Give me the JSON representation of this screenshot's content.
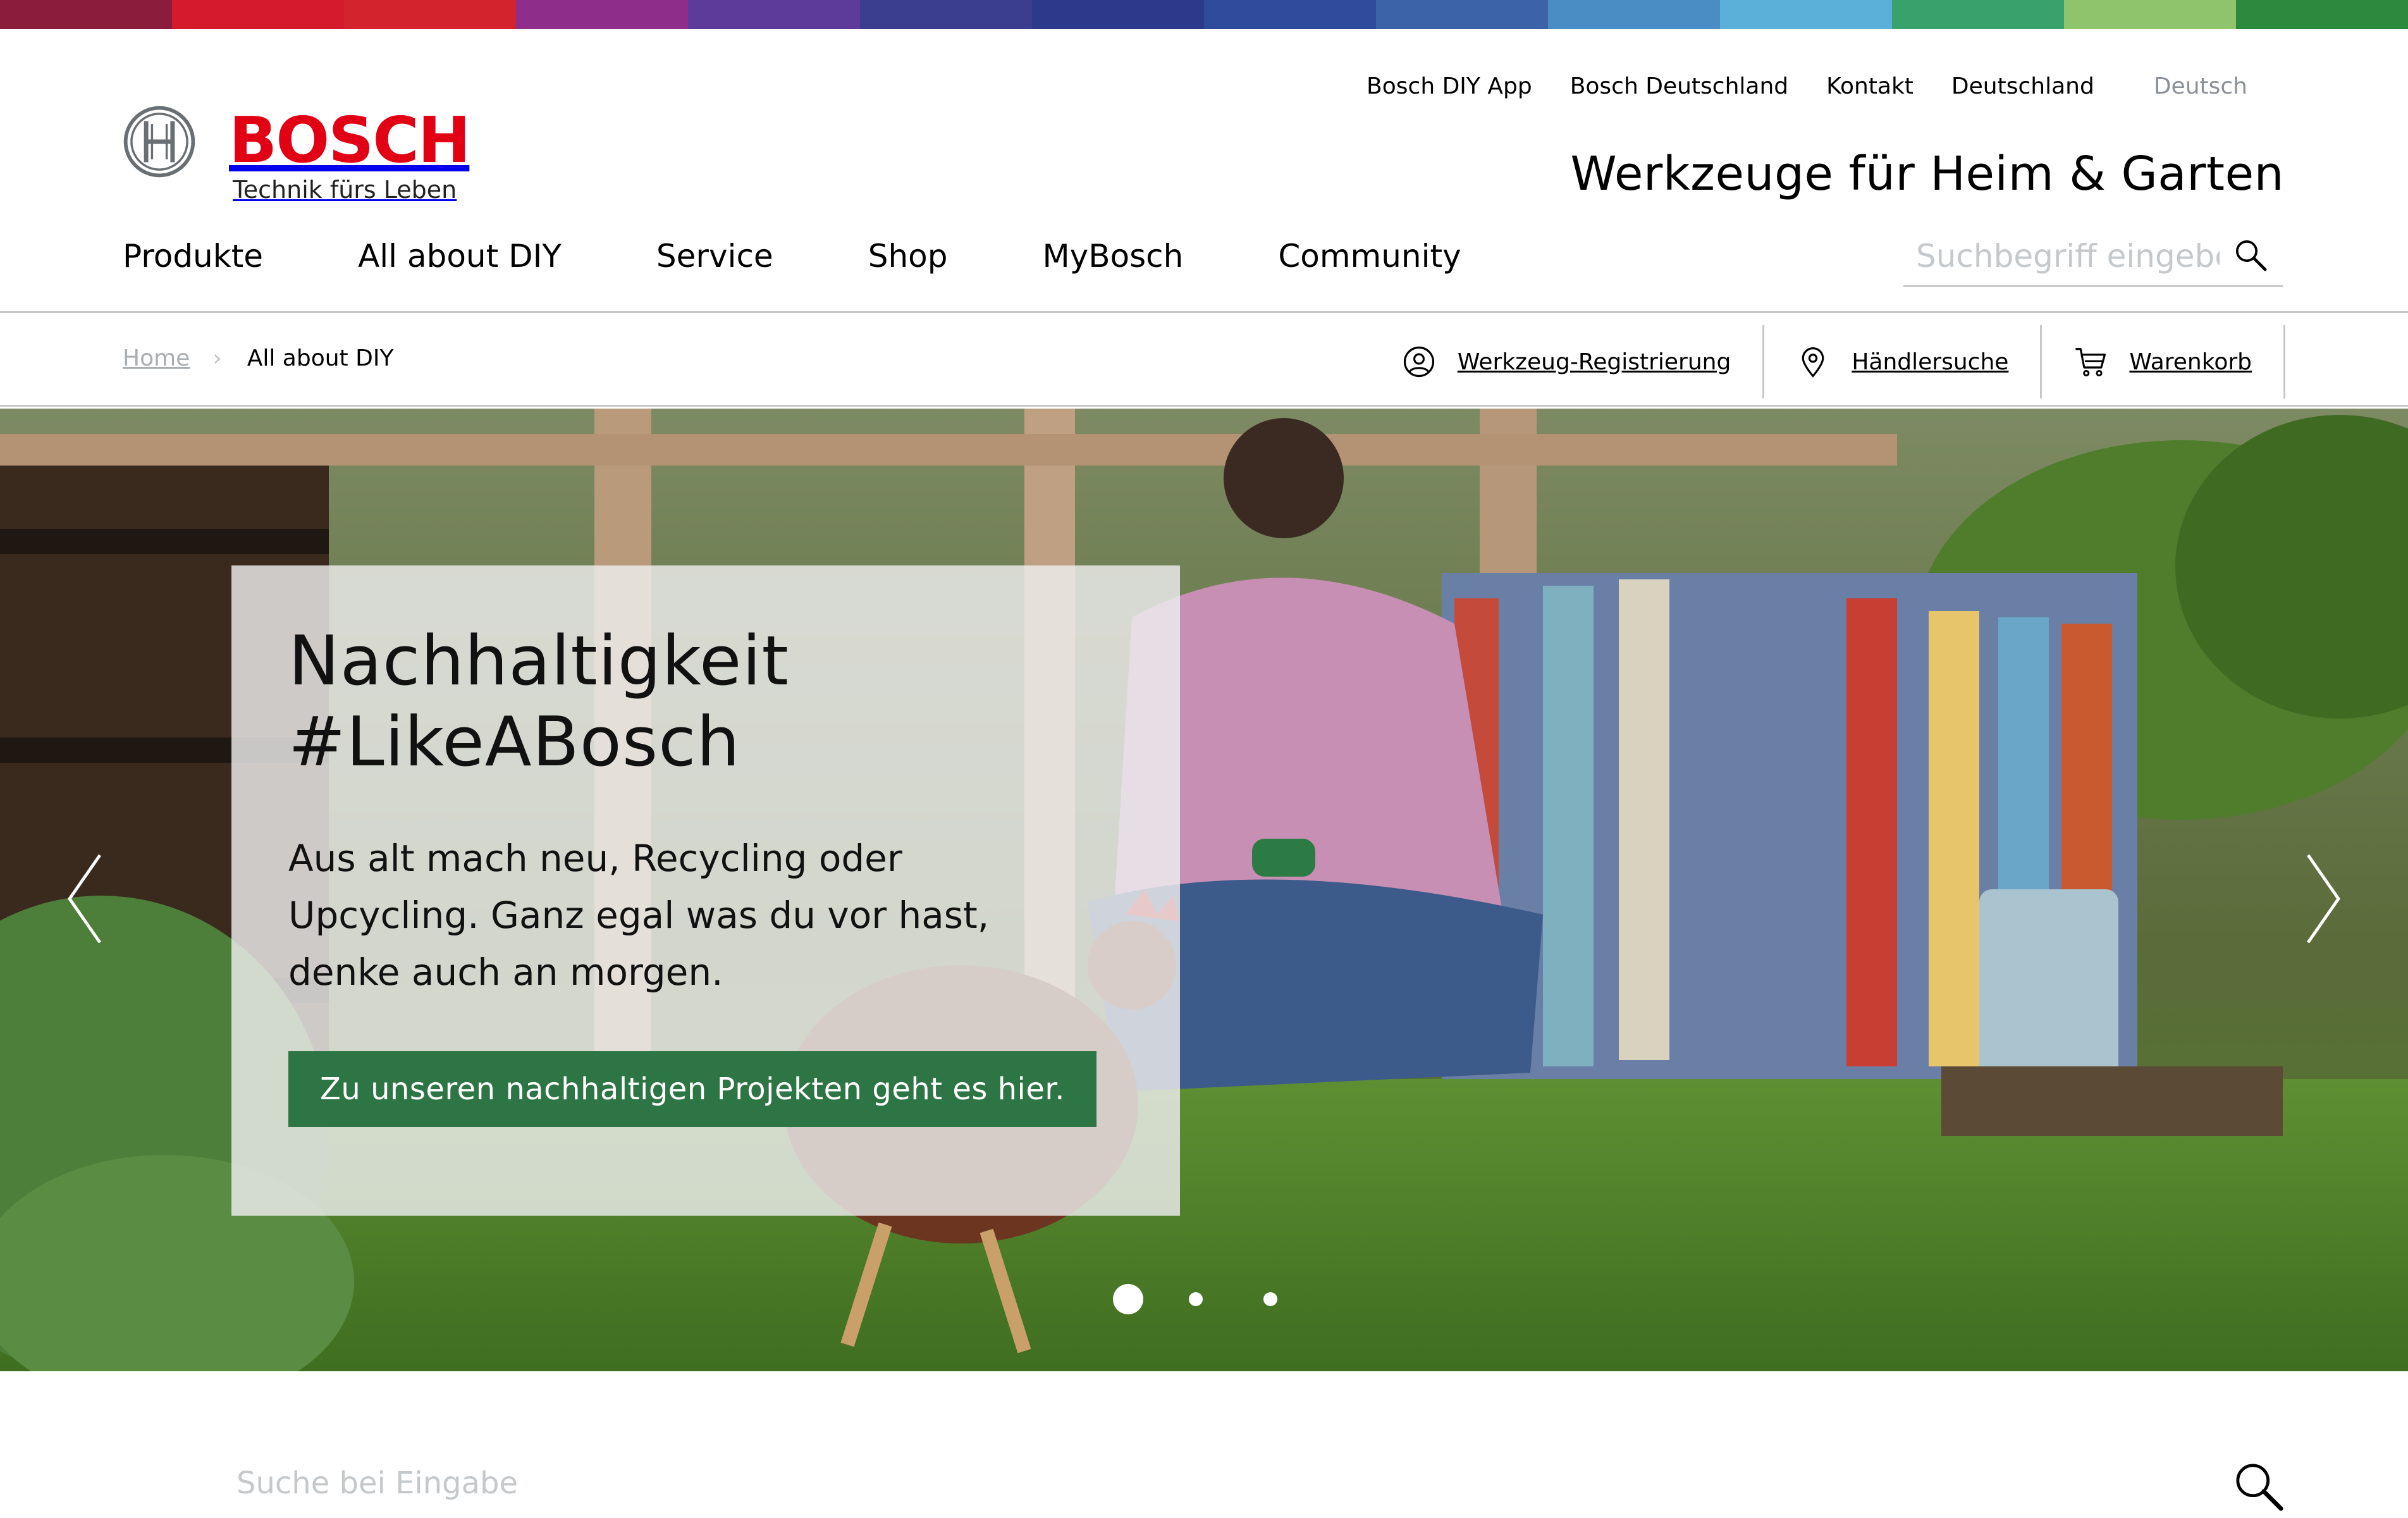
{
  "brand": {
    "name": "BOSCH",
    "tagline": "Technik fürs Leben",
    "accent": "#e20015"
  },
  "rainbow_colors": [
    "#8c1c3c",
    "#d51b2b",
    "#d3232c",
    "#8e2d8a",
    "#5c3b9a",
    "#3b3d8f",
    "#2b3a8a",
    "#304b9c",
    "#3c62a8",
    "#4a8dc4",
    "#5ab0d9",
    "#39a16b",
    "#8fc46c",
    "#2c8a3e"
  ],
  "meta_nav": {
    "items": [
      "Bosch DIY App",
      "Bosch Deutschland",
      "Kontakt",
      "Deutschland"
    ],
    "language": "Deutsch"
  },
  "site_title": "Werkzeuge für Heim & Garten",
  "main_nav": [
    "Produkte",
    "All about DIY",
    "Service",
    "Shop",
    "MyBosch",
    "Community"
  ],
  "header_search": {
    "placeholder": "Suchbegriff eingeben",
    "icon": "search-icon"
  },
  "breadcrumb": {
    "home": "Home",
    "current": "All about DIY"
  },
  "tools": [
    {
      "label": "Werkzeug-Registrierung",
      "icon": "user-circle-icon"
    },
    {
      "label": "Händlersuche",
      "icon": "location-pin-icon"
    },
    {
      "label": "Warenkorb",
      "icon": "cart-icon"
    }
  ],
  "hero": {
    "title_line1": "Nachhaltigkeit",
    "title_line2": "#LikeABosch",
    "text": "Aus alt mach neu, Recycling oder Upcycling. Ganz egal was du vor hast, denke auch an morgen.",
    "button_label": "Zu unseren nachhaltigen Projekten geht es hier.",
    "button_color": "#2d7544",
    "slide_count": 3,
    "active_slide": 1
  },
  "bottom_search": {
    "placeholder": "Suche bei Eingabe",
    "icon": "search-icon"
  }
}
